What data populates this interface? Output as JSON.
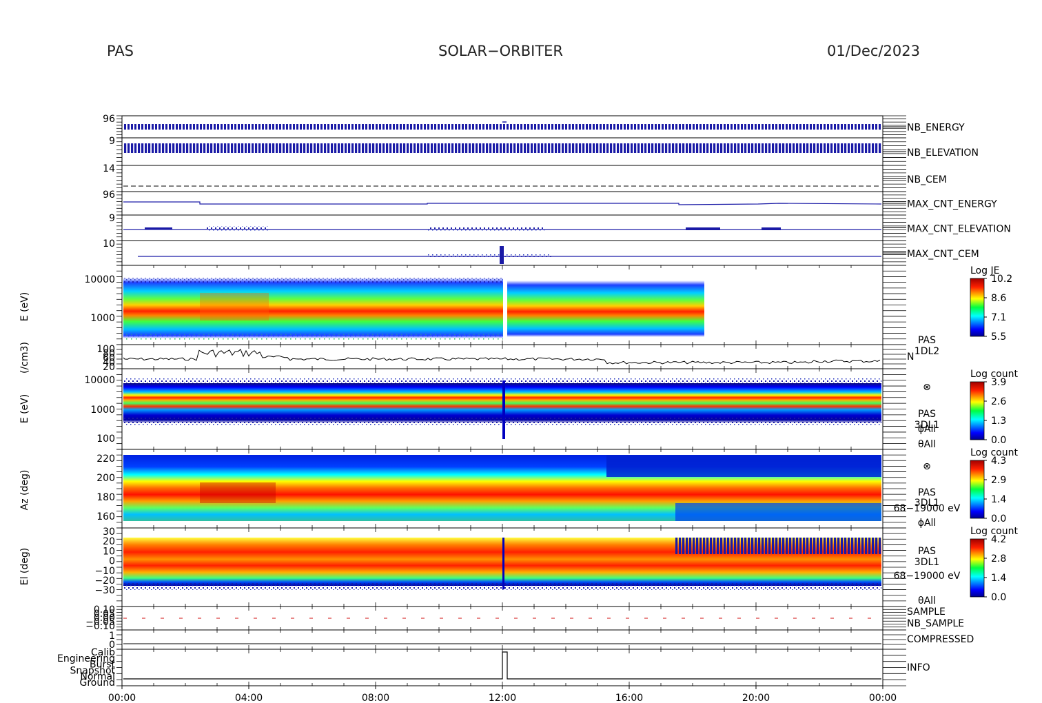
{
  "header": {
    "instrument": "PAS",
    "mission": "SOLAR−ORBITER",
    "date": "01/Dec/2023"
  },
  "chart_data": {
    "type": "heatmap",
    "x_ticks": [
      "00:00",
      "04:00",
      "08:00",
      "12:00",
      "16:00",
      "20:00",
      "00:00"
    ],
    "hk_panels": [
      {
        "id": "nb-energy",
        "label": "NB_ENERGY",
        "color": "blue",
        "tick_text": "96"
      },
      {
        "id": "nb-elevation",
        "label": "NB_ELEVATION",
        "color": "blue",
        "tick_text": "9"
      },
      {
        "id": "nb-cem",
        "label": "NB_CEM",
        "color": "blue",
        "tick_text": "14"
      },
      {
        "id": "max-cnt-energy",
        "label": "MAX_CNT_ENERGY",
        "color": "blue",
        "tick_text": "96"
      },
      {
        "id": "max-cnt-elevation",
        "label": "MAX_CNT_ELEVATION",
        "color": "blue",
        "tick_text": "9"
      },
      {
        "id": "max-cnt-cem",
        "label": "MAX_CNT_CEM",
        "color": "blue",
        "tick_text": "10"
      }
    ],
    "energy_panel": {
      "ylabel": "E (eV)",
      "yticks": [
        "10000",
        "1000"
      ],
      "colorbar": {
        "title": "Log JE",
        "ticks": [
          "10.2",
          "8.6",
          "7.1",
          "5.5"
        ]
      }
    },
    "density_panel": {
      "ylabel": "(/cm3)",
      "yticks": [
        "100",
        "80",
        "60",
        "40",
        "20"
      ],
      "side_label": [
        "PAS",
        "1DL2",
        "N"
      ]
    },
    "spec_energy_panel": {
      "ylabel": "E (eV)",
      "yticks": [
        "10000",
        "1000",
        "100"
      ],
      "colorbar": {
        "title": "Log count",
        "ticks": [
          "3.9",
          "2.6",
          "1.3",
          "0.0"
        ]
      },
      "side_labels": [
        "⊗",
        "PAS",
        "3DL1",
        "ϕAll",
        "θAll"
      ]
    },
    "azimuth_panel": {
      "ylabel": "Az (deg)",
      "yticks": [
        "220",
        "200",
        "180",
        "160"
      ],
      "colorbar": {
        "title": "Log count",
        "ticks": [
          "4.3",
          "2.9",
          "1.4",
          "0.0"
        ]
      },
      "side_labels": [
        "⊗",
        "PAS",
        "3DL1",
        "68−19000 eV",
        "ϕAll"
      ]
    },
    "elevation_panel": {
      "ylabel": "El (deg)",
      "yticks": [
        "30",
        "20",
        "10",
        "0",
        "−10",
        "−20",
        "−30"
      ],
      "colorbar": {
        "title": "Log count",
        "ticks": [
          "4.2",
          "2.8",
          "1.4",
          "0.0"
        ]
      },
      "side_labels": [
        "PAS",
        "3DL1",
        "68−19000 eV",
        "θAll"
      ]
    },
    "sample_panel": {
      "labels": [
        {
          "text": "SAMPLE",
          "color": "blue"
        },
        {
          "text": "NB_SAMPLE",
          "color": "red"
        }
      ],
      "yticks": [
        "0.10",
        "0.05",
        "0.00",
        "−0.05",
        "−0.10"
      ]
    },
    "compressed_panel": {
      "label": "COMPRESSED",
      "yticks": [
        "1",
        "0"
      ]
    },
    "info_panel": {
      "label": "INFO",
      "yticks": [
        "Calib",
        "Engineering",
        "Burst",
        "Snapshot",
        "Normal",
        "Ground"
      ]
    }
  }
}
